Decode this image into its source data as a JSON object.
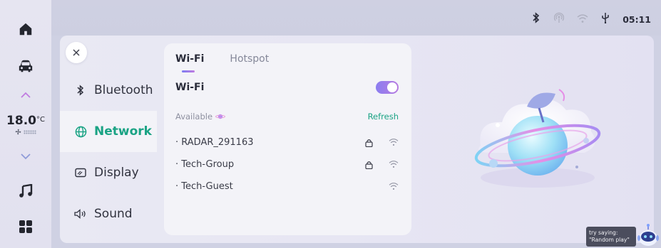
{
  "status_bar": {
    "time": "05:11",
    "icons": [
      "bluetooth-icon",
      "hotspot-icon",
      "wifi-icon",
      "usb-icon"
    ]
  },
  "rail": {
    "items": [
      "home-icon",
      "car-icon",
      "temp-up-icon",
      "temp-down-icon",
      "music-icon",
      "apps-grid-icon"
    ],
    "temperature": "18.0",
    "temperature_unit": "°C"
  },
  "settings": {
    "close_label": "×",
    "menu": [
      {
        "label": "Bluetooth",
        "icon": "bluetooth-icon",
        "active": false
      },
      {
        "label": "Network",
        "icon": "globe-icon",
        "active": true
      },
      {
        "label": "Display",
        "icon": "display-icon",
        "active": false
      },
      {
        "label": "Sound",
        "icon": "speaker-icon",
        "active": false
      }
    ]
  },
  "network_card": {
    "tabs": [
      {
        "label": "Wi-Fi",
        "active": true
      },
      {
        "label": "Hotspot",
        "active": false
      }
    ],
    "wifi_label": "Wi-Fi",
    "wifi_enabled": true,
    "available_label": "Available",
    "refresh_label": "Refresh",
    "networks": [
      {
        "name": "RADAR_291163",
        "locked": true
      },
      {
        "name": "Tech-Group",
        "locked": true
      },
      {
        "name": "Tech-Guest",
        "locked": false
      }
    ]
  },
  "voice_hint": {
    "line1": "try saying:",
    "line2": "\"Random play\""
  },
  "colors": {
    "accent_green": "#1aa384",
    "toggle_gradient": [
      "#8b7df0",
      "#b77be0"
    ],
    "rail_bg": "#e4e3f0",
    "panel_bg": "#e8e8f3"
  }
}
